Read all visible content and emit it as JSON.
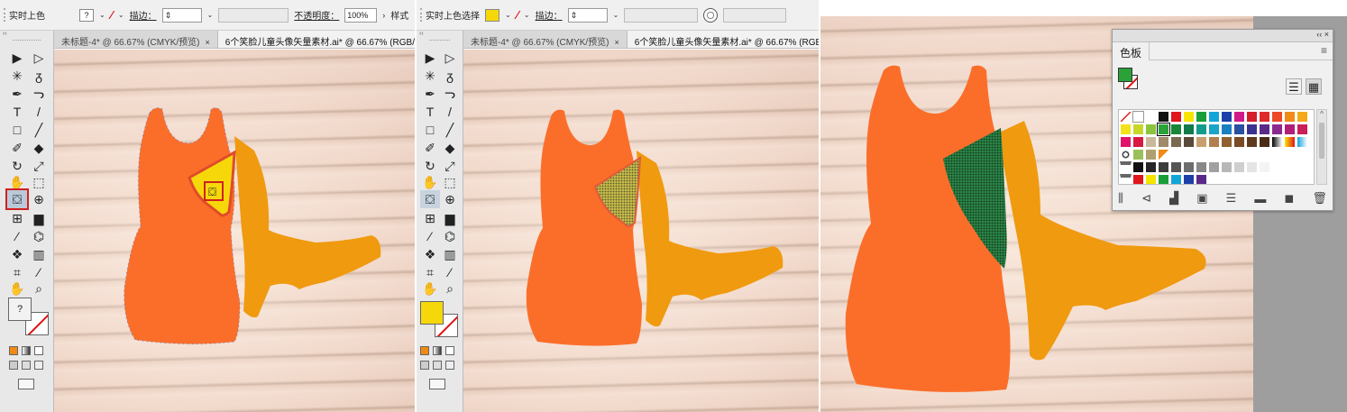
{
  "panel1": {
    "control_label": "实时上色",
    "fill_value": "?",
    "stroke_label": "描边：",
    "opacity_label": "不透明度：",
    "opacity_value": "100%",
    "style_label": "样式",
    "arrow": "›",
    "tab1": "未标题-4* @ 66.67% (CMYK/预览)",
    "tab2": "6个笑脸儿童头像矢量素材.ai* @ 66.67% (RGB/预览)",
    "close": "×",
    "fill_swatch_color": "#f2f2f2",
    "highlight_color": "#f6d80a"
  },
  "panel2": {
    "control_label": "实时上色选择",
    "stroke_label": "描边：",
    "tab1": "未标题-4* @ 66.67% (CMYK/预览)",
    "tab2": "6个笑脸儿童头像矢量素材.ai* @ 66.67% (RGB/预",
    "close": "×",
    "fill_swatch_color": "#f6d80a"
  },
  "panel3": {
    "swatches_title": "色板",
    "menu_icon": "≡",
    "panel_top": "‹‹  ×",
    "current_fill": "#2aa238",
    "scroll_up": "^",
    "scroll_down": "v"
  },
  "colors": {
    "dress": "#fb6e2a",
    "boot": "#f09a10",
    "sel_green": "#1f7a3a"
  },
  "icons": {
    "selection": "▶",
    "direct": "▷",
    "magic": "✳",
    "lasso": "ᵹ",
    "pen": "✒",
    "curv": "ᓓ",
    "type": "T",
    "line": "/",
    "rect": "□",
    "brush": "╱",
    "shaper": "✐",
    "eraser": "◆",
    "rotate": "↻",
    "scale": "⤢",
    "puppet": "✋",
    "free": "⬚",
    "shapebuild": "⊕",
    "livepaint": "⛋",
    "mesh": "⊞",
    "gradient": "▆",
    "eyedrop": "⁄",
    "blend": "⌬",
    "symbol": "❖",
    "graph": "▥",
    "artboard": "⌗",
    "slice": "⁄",
    "hand": "✋",
    "zoom": "⌕",
    "view_list": "☰",
    "view_grid": "▦",
    "libraries": "⫼",
    "swatch_kinds": "⊲",
    "color_groups": "▟",
    "swatch_options": "▣",
    "new_group": "▬",
    "new_swatch": "◼",
    "delete": "🗑"
  }
}
